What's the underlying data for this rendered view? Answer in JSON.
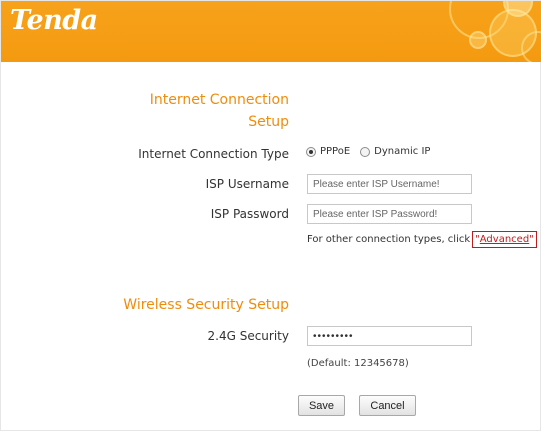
{
  "header": {
    "logo_text": "Tenda",
    "accent_color": "#f49a10"
  },
  "internet": {
    "title_line1": "Internet Connection",
    "title_line2": "Setup",
    "connection_type_label": "Internet Connection Type",
    "options": [
      {
        "label": "PPPoE",
        "selected": true
      },
      {
        "label": "Dynamic IP",
        "selected": false
      }
    ],
    "isp_username_label": "ISP Username",
    "isp_username_placeholder": "Please enter ISP Username!",
    "isp_password_label": "ISP Password",
    "isp_password_placeholder": "Please enter ISP Password!",
    "other_text": "For other connection types, click",
    "advanced_quote_open": "\"",
    "advanced_label": "Advanced",
    "advanced_quote_close": "\""
  },
  "wireless": {
    "title": "Wireless Security Setup",
    "security_label": "2.4G Security",
    "security_value": "•••••••••",
    "default_note": "(Default: 12345678)"
  },
  "buttons": {
    "save": "Save",
    "cancel": "Cancel"
  }
}
